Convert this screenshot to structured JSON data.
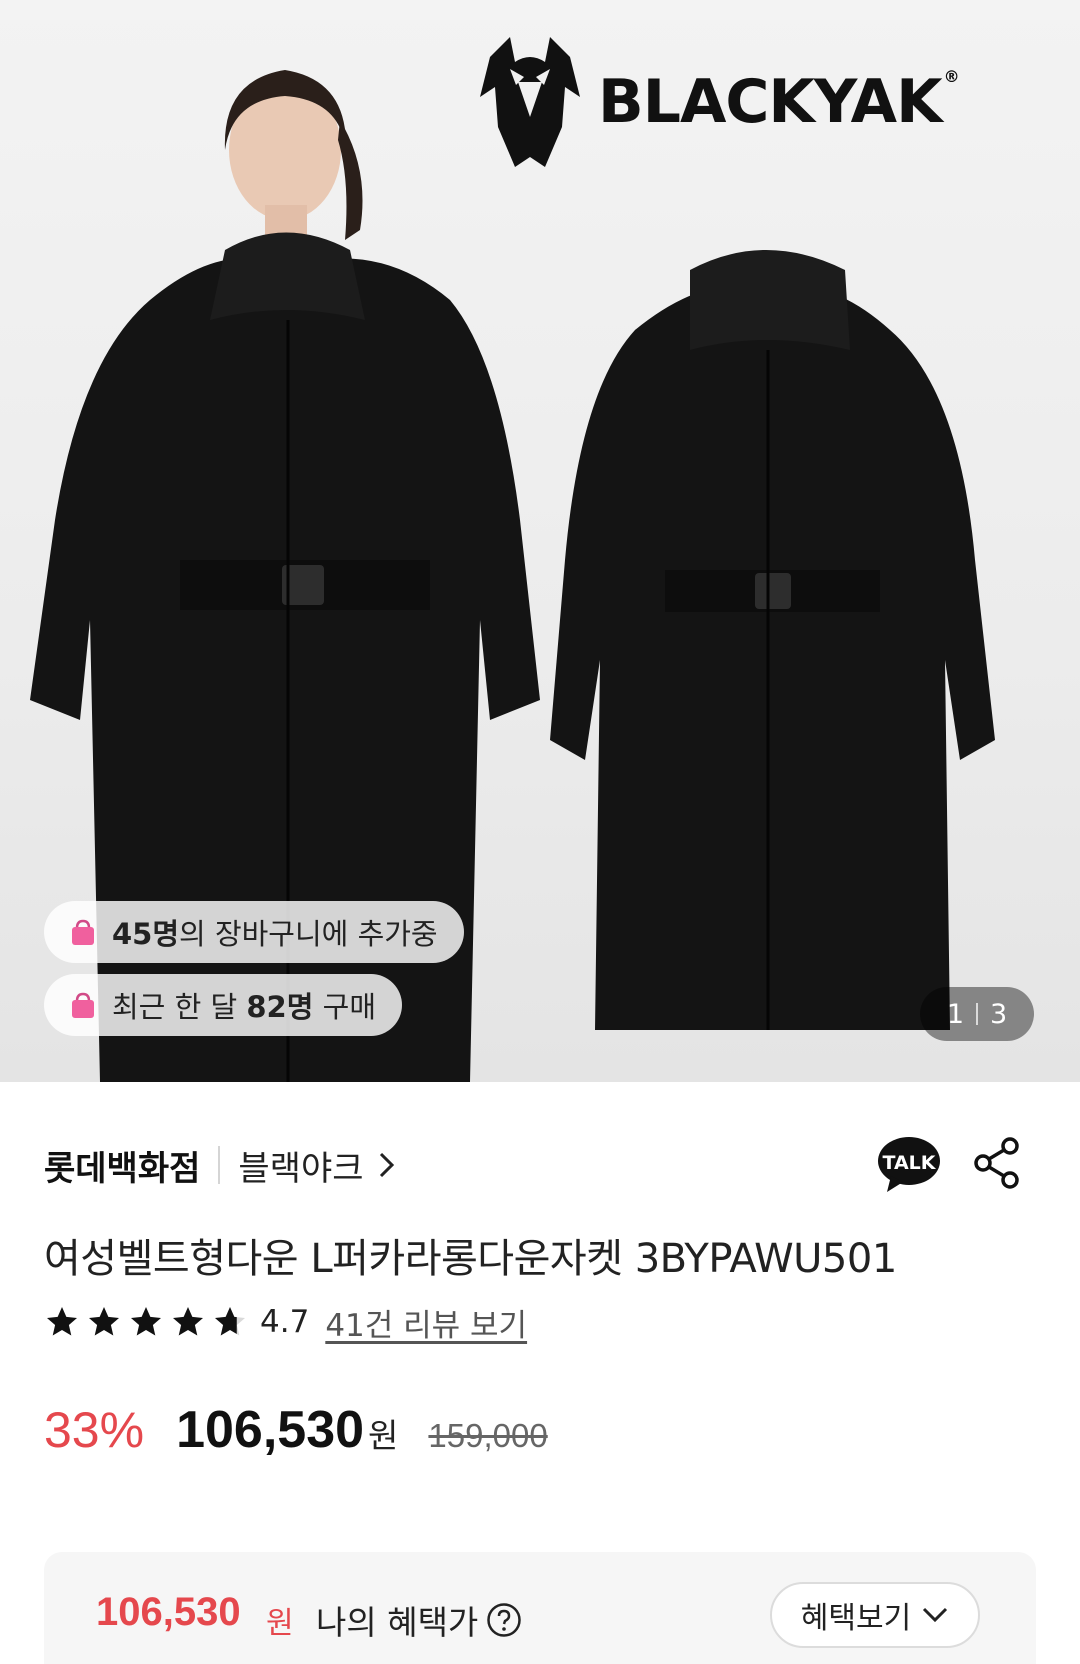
{
  "hero": {
    "brand_name": "BLACKYAK",
    "brand_reg": "®",
    "cart_badge": {
      "count": "45명",
      "text": "의 장바구니에 추가중"
    },
    "purchase_badge": {
      "prefix": "최근 한 달 ",
      "count": "82명",
      "suffix": " 구매"
    },
    "image_counter": {
      "current": "1",
      "total": "3"
    }
  },
  "store": {
    "name": "롯데백화점",
    "brand": "블랙야크",
    "talk_label": "TALK"
  },
  "product": {
    "title": "여성벨트형다운 L퍼카라롱다운자켓 3BYPAWU501",
    "rating": 4.7,
    "rating_text": "4.7",
    "review_link": "41건 리뷰 보기"
  },
  "price": {
    "discount": "33%",
    "sale": "106,530",
    "won": "원",
    "original": "159,000"
  },
  "benefit": {
    "price": "106,530",
    "won": "원",
    "label": "나의 혜택가",
    "button": "혜택보기"
  },
  "colors": {
    "accent_red": "#e5484d",
    "pill_bag": "#f0609e",
    "coat": "#141414"
  },
  "icons": [
    "yak-logo-icon",
    "shopping-bag-icon",
    "chevron-right-icon",
    "talk-icon",
    "share-icon",
    "star-icon",
    "question-circle-icon",
    "chevron-down-icon"
  ]
}
